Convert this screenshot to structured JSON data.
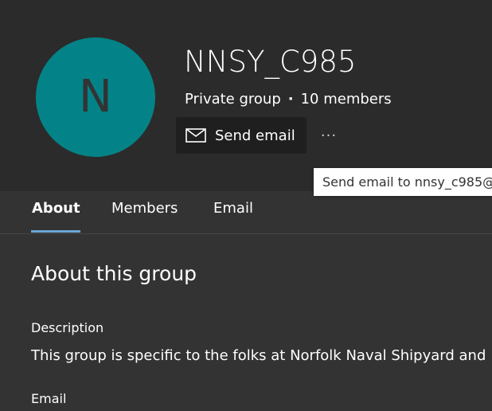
{
  "group": {
    "avatar_initial": "N",
    "avatar_color": "#038387",
    "name": "NNSY_C985",
    "privacy": "Private group",
    "separator": "·",
    "member_count": "10 members"
  },
  "actions": {
    "send_email_label": "Send email",
    "send_email_icon": "mail-icon",
    "more_label": "···",
    "more_icon": "more-options-icon"
  },
  "tooltip": {
    "text": "Send email to nnsy_c985@"
  },
  "tabs": [
    {
      "label": "About",
      "active": true
    },
    {
      "label": "Members",
      "active": false
    },
    {
      "label": "Email",
      "active": false
    }
  ],
  "about": {
    "title": "About this group",
    "description_label": "Description",
    "description_value": "This group is specific to the folks at Norfolk Naval Shipyard and",
    "email_label": "Email"
  },
  "colors": {
    "background": "#333333",
    "header_background": "#2b2b2b",
    "button_background": "#1f1f1f",
    "tab_accent": "#6ca6d6"
  }
}
